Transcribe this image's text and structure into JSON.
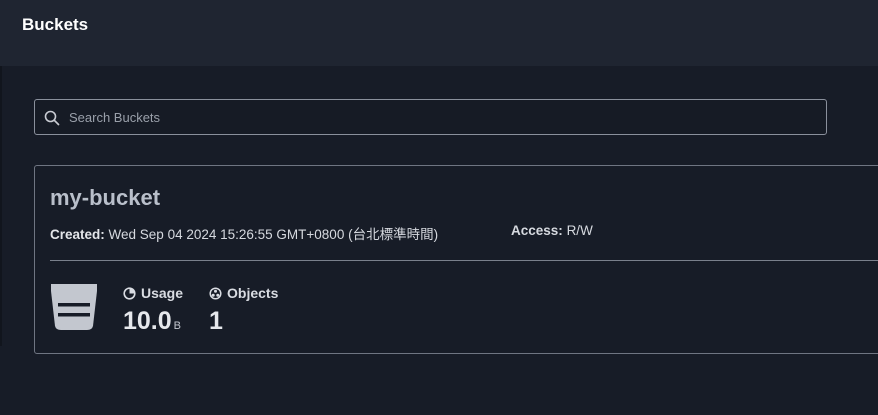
{
  "header": {
    "title": "Buckets"
  },
  "search": {
    "placeholder": "Search Buckets",
    "value": "",
    "icon": "search-icon"
  },
  "bucket": {
    "name": "my-bucket",
    "created_label": "Created:",
    "created_value": "Wed Sep 04 2024 15:26:55 GMT+0800 (台北標準時間)",
    "access_label": "Access:",
    "access_value": "R/W",
    "usage_label": "Usage",
    "usage_value": "10.0",
    "usage_unit": "B",
    "objects_label": "Objects",
    "objects_value": "1",
    "icons": {
      "bucket": "bucket-icon",
      "usage": "pie-chart-icon",
      "objects": "objects-icon"
    }
  },
  "colors": {
    "background": "#171c27",
    "header": "#1f2531",
    "border": "#6f7582",
    "bucket_name": "#b9bfca"
  }
}
